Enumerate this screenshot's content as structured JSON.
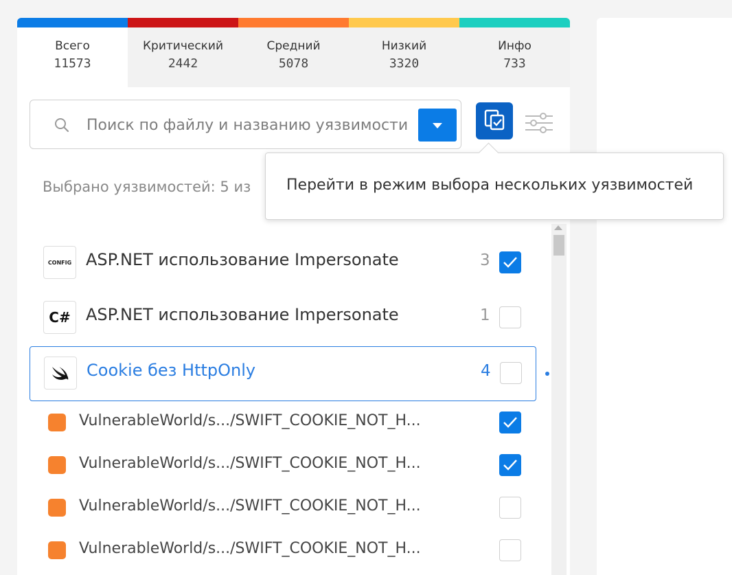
{
  "severity_colors": [
    "#0b7ce6",
    "#cc1416",
    "#ff7a2f",
    "#ffc94d",
    "#1ccfc0"
  ],
  "tabs": [
    {
      "label": "Всего",
      "count": "11573"
    },
    {
      "label": "Критический",
      "count": "2442"
    },
    {
      "label": "Средний",
      "count": "5078"
    },
    {
      "label": "Низкий",
      "count": "3320"
    },
    {
      "label": "Инфо",
      "count": "733"
    }
  ],
  "search": {
    "placeholder": "Поиск по файлу и названию уязвимости",
    "value": ""
  },
  "selected_text": "Выбрано уязвимостей: 5 из",
  "tooltip": "Перейти в режим выбора нескольких уязвимостей",
  "groups": [
    {
      "icon": "CONFIG",
      "title": "ASP.NET использование Impersonate",
      "count": "3",
      "checked": true
    },
    {
      "icon": "C#",
      "title": "ASP.NET использование Impersonate",
      "count": "1",
      "checked": false
    },
    {
      "icon": "swift-icon",
      "title": "Cookie без HttpOnly",
      "count": "4",
      "checked": false
    }
  ],
  "files": [
    {
      "path": "VulnerableWorld/s.../SWIFT_COOKIE_NOT_H...",
      "checked": true
    },
    {
      "path": "VulnerableWorld/s.../SWIFT_COOKIE_NOT_H...",
      "checked": true
    },
    {
      "path": "VulnerableWorld/s.../SWIFT_COOKIE_NOT_H...",
      "checked": false
    },
    {
      "path": "VulnerableWorld/s.../SWIFT_COOKIE_NOT_H...",
      "checked": false
    }
  ]
}
